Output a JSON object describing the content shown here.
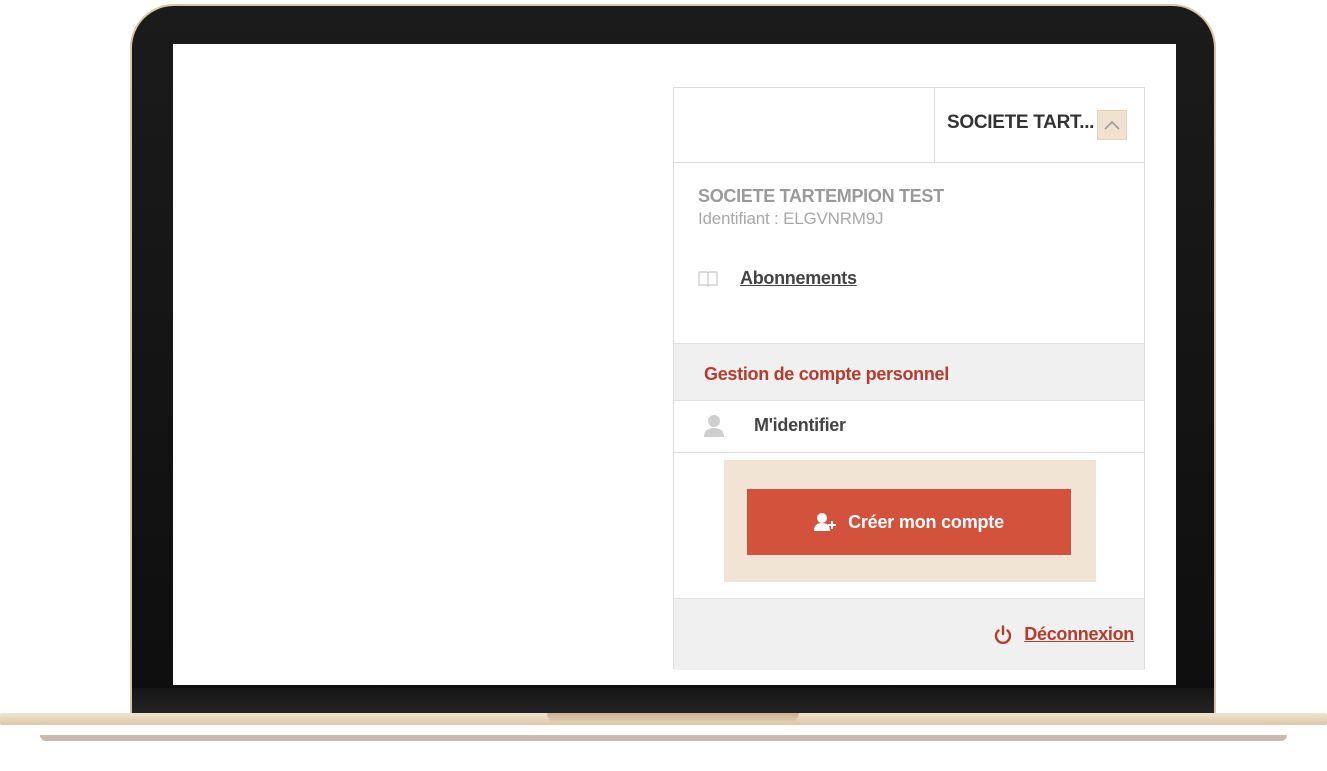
{
  "account_menu": {
    "header_label": "SOCIETE TART...",
    "toggle_icon": "chevron-up-icon",
    "company_name": "SOCIETE TARTEMPION TEST",
    "company_id": "Identifiant : ELGVNRM9J",
    "subscriptions_link": "Abonnements",
    "subscriptions_icon": "book-icon",
    "section_title": "Gestion de compte personnel",
    "login_label": "M'identifier",
    "login_icon": "user-icon",
    "create_account_label": "Créer mon compte",
    "create_account_icon": "add-user-icon",
    "logout_label": "Déconnexion",
    "logout_icon": "power-icon"
  },
  "colors": {
    "accent_red": "#d2523c",
    "section_red": "#b83a2a",
    "beige": "#f1e4d4"
  }
}
